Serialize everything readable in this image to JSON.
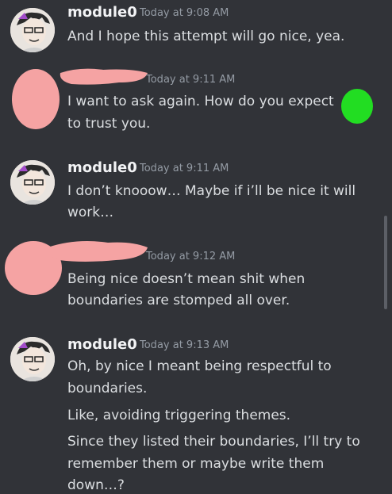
{
  "messages": [
    {
      "author": "module0",
      "time": "Today at 9:08 AM",
      "lines": [
        "And I hope this attempt will go nice, yea."
      ]
    },
    {
      "author": "",
      "time": "Today at 9:11 AM",
      "lines": [
        "I want to ask again. How do you expect",
        "to trust you."
      ]
    },
    {
      "author": "module0",
      "time": "Today at 9:11 AM",
      "lines": [
        "I don’t knooow… Maybe if i’ll be nice it will",
        "work…"
      ]
    },
    {
      "author": "",
      "time": "Today at 9:12 AM",
      "lines": [
        "Being nice doesn’t mean shit when",
        "boundaries are stomped all over."
      ]
    },
    {
      "author": "module0",
      "time": "Today at 9:13 AM",
      "lines": [
        "Oh, by nice I meant being respectful to",
        "boundaries.",
        "Like, avoiding triggering themes.",
        "Since they listed their boundaries, I’ll try to",
        "remember them or maybe write them",
        "down…?"
      ]
    }
  ],
  "colors": {
    "background": "#313338",
    "text": "#dbdee1",
    "username": "#f2f3f5",
    "timestamp": "#949ba4",
    "redaction_pink": "#f5a3a3",
    "redaction_green": "#22dd22"
  }
}
